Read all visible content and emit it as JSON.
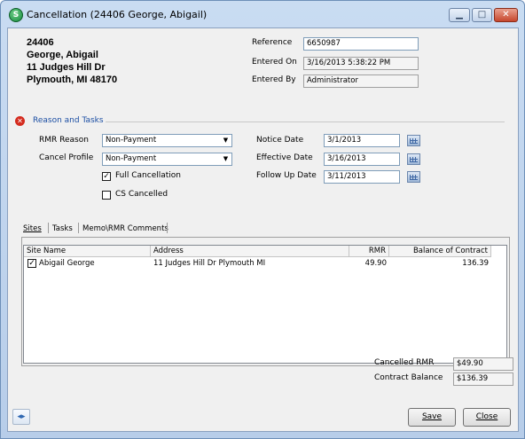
{
  "window": {
    "title": "Cancellation (24406 George, Abigail)",
    "app_icon_letter": "S",
    "min_glyph": "▁",
    "max_glyph": "□",
    "close_glyph": "✕"
  },
  "account": {
    "number": "24406",
    "name": "George, Abigail",
    "address1": "11  Judges Hill Dr",
    "address2": "Plymouth, MI  48170"
  },
  "meta": {
    "reference_label": "Reference",
    "reference_value": "6650987",
    "entered_on_label": "Entered On",
    "entered_on_value": "3/16/2013 5:38:22 PM",
    "entered_by_label": "Entered By",
    "entered_by_value": "Administrator"
  },
  "section": {
    "title": "Reason and Tasks",
    "error_glyph": "✕"
  },
  "form": {
    "rmr_reason_label": "RMR Reason",
    "rmr_reason_value": "Non-Payment",
    "cancel_profile_label": "Cancel Profile",
    "cancel_profile_value": "Non-Payment",
    "full_cancellation_label": "Full Cancellation",
    "full_cancellation_checked": true,
    "cs_cancelled_label": "CS Cancelled",
    "cs_cancelled_checked": false,
    "notice_date_label": "Notice Date",
    "notice_date_value": "3/1/2013",
    "effective_date_label": "Effective Date",
    "effective_date_value": "3/16/2013",
    "follow_up_label": "Follow Up Date",
    "follow_up_value": "3/11/2013",
    "dropdown_arrow": "▼",
    "check_glyph": "✓"
  },
  "tabs": [
    "Sites",
    "Tasks",
    "Memo\\RMR Comments"
  ],
  "grid": {
    "columns": [
      "Site Name",
      "Address",
      "RMR",
      "Balance of Contract"
    ],
    "rows": [
      {
        "checked": true,
        "site_name": "Abigail George",
        "address": "11  Judges Hill Dr Plymouth MI",
        "rmr": "49.90",
        "balance": "136.39"
      }
    ]
  },
  "totals": {
    "cancelled_rmr_label": "Cancelled RMR",
    "cancelled_rmr_value": "$49.90",
    "contract_balance_label": "Contract Balance",
    "contract_balance_value": "$136.39"
  },
  "footer": {
    "nav_glyph": "◂▸",
    "save_label": "Save",
    "close_label": "Close"
  }
}
